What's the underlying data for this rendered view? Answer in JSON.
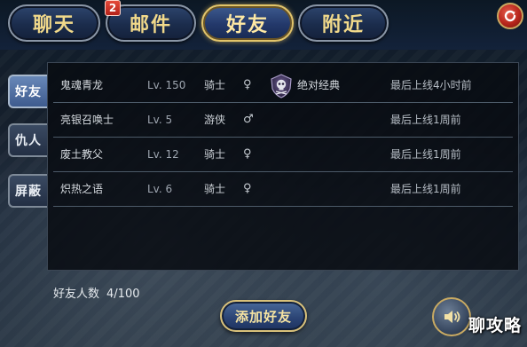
{
  "top_tabs": [
    {
      "label": "聊天"
    },
    {
      "label": "邮件",
      "badge": "2"
    },
    {
      "label": "好友"
    },
    {
      "label": "附近"
    }
  ],
  "active_top_tab": "好友",
  "side_tabs": [
    {
      "label": "好友"
    },
    {
      "label": "仇人"
    },
    {
      "label": "屏蔽"
    }
  ],
  "active_side_tab": "好友",
  "friends": [
    {
      "name": "鬼魂青龙",
      "level": "Lv. 150",
      "class": "骑士",
      "gender": "♀",
      "guild": "绝对经典",
      "guild_icon": "skull-crest-icon",
      "last_online": "最后上线4小时前"
    },
    {
      "name": "亮银召唤士",
      "level": "Lv. 5",
      "class": "游侠",
      "gender": "♂",
      "guild": "",
      "last_online": "最后上线1周前"
    },
    {
      "name": "废土教父",
      "level": "Lv. 12",
      "class": "骑士",
      "gender": "♀",
      "guild": "",
      "last_online": "最后上线1周前"
    },
    {
      "name": "炽热之语",
      "level": "Lv. 6",
      "class": "骑士",
      "gender": "♀",
      "guild": "",
      "last_online": "最后上线1周前"
    }
  ],
  "footer": {
    "friend_count_label": "好友人数",
    "friend_count_value": "4/100",
    "add_friend_label": "添加好友",
    "voice_icon": "speaker-icon"
  },
  "watermark": "聊攻略",
  "colors": {
    "tab_text": "#f1d98a",
    "active_tab_border": "#e2c46a",
    "badge_red": "#d23a2c",
    "close_red": "#b8261c"
  }
}
